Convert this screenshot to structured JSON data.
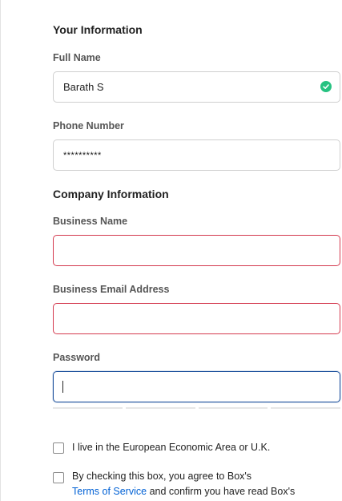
{
  "your_info": {
    "heading": "Your Information",
    "full_name_label": "Full Name",
    "full_name_value": "Barath S",
    "phone_label": "Phone Number",
    "phone_value": "**********"
  },
  "company_info": {
    "heading": "Company Information",
    "business_name_label": "Business Name",
    "business_name_value": "",
    "business_email_label": "Business Email Address",
    "business_email_value": "",
    "password_label": "Password",
    "password_value": ""
  },
  "checkboxes": {
    "eea_label": "I live in the European Economic Area or U.K.",
    "terms_prefix": "By checking this box, you agree to Box's",
    "terms_link": "Terms of Service",
    "terms_suffix": " and confirm you have read Box's"
  },
  "colors": {
    "error_border": "#d43a4f",
    "focus_border": "#1b4f9c",
    "valid_green": "#26c281",
    "link": "#0061d5"
  },
  "icons": {
    "valid": "check-circle-icon"
  }
}
